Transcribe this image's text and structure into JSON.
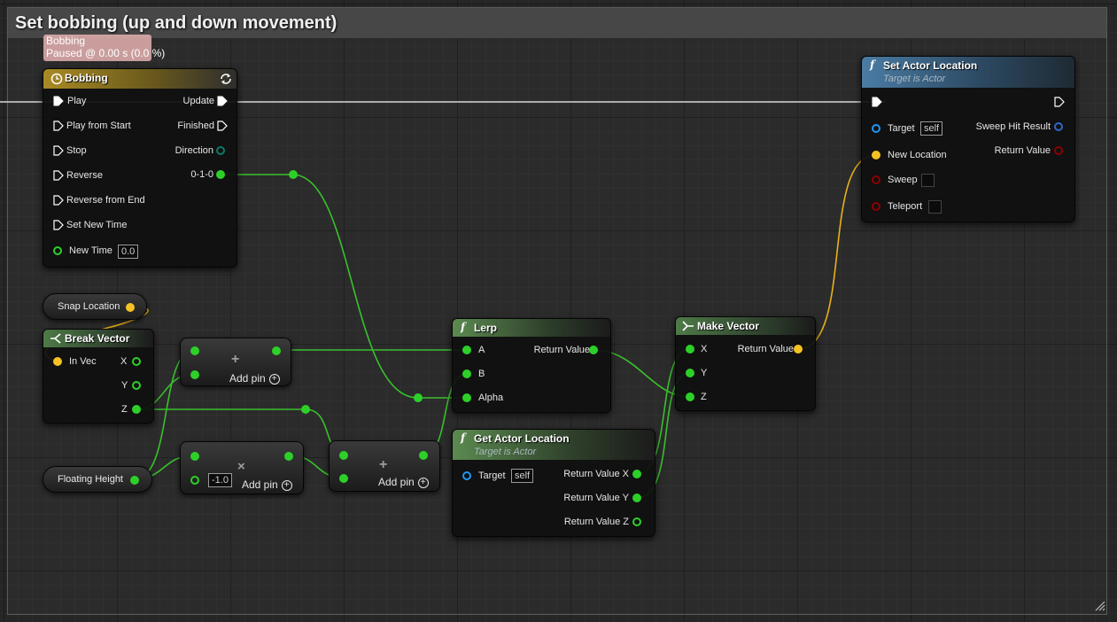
{
  "comment": {
    "title": "Set bobbing (up and down movement)"
  },
  "tooltip": {
    "line1": "Bobbing",
    "line2": "Paused @ 0.00 s (0.0 %)"
  },
  "colors": {
    "exec": "#ffffff",
    "float": "#2dd028",
    "vector": "#f4c223",
    "object": "#2196f3",
    "struct": "#2b6ac9",
    "bool": "#8e0000",
    "timeline_header": "#a48625",
    "function_header": "#78c8f0",
    "pure_header": "#4d7f42"
  },
  "timeline": {
    "title": "Bobbing",
    "inputs": [
      "Play",
      "Play from Start",
      "Stop",
      "Reverse",
      "Reverse from End",
      "Set New Time"
    ],
    "new_time_label": "New Time",
    "new_time_value": "0.0",
    "outputs": [
      "Update",
      "Finished",
      "Direction",
      "0-1-0"
    ]
  },
  "snap_location": {
    "label": "Snap Location"
  },
  "floating_height": {
    "label": "Floating Height"
  },
  "break_vector": {
    "title": "Break Vector",
    "input": "In Vec",
    "outputs": [
      "X",
      "Y",
      "Z"
    ]
  },
  "add_node_1": {
    "add_pin": "Add pin"
  },
  "mult_node": {
    "add_pin": "Add pin",
    "value": "-1.0"
  },
  "add_node_2": {
    "add_pin": "Add pin"
  },
  "lerp": {
    "title": "Lerp",
    "inputs": [
      "A",
      "B",
      "Alpha"
    ],
    "output": "Return Value"
  },
  "get_actor_location": {
    "title": "Get Actor Location",
    "subtitle": "Target is Actor",
    "target_label": "Target",
    "target_value": "self",
    "outputs": [
      "Return Value X",
      "Return Value Y",
      "Return Value Z"
    ]
  },
  "make_vector": {
    "title": "Make Vector",
    "inputs": [
      "X",
      "Y",
      "Z"
    ],
    "output": "Return Value"
  },
  "set_actor_location": {
    "title": "Set Actor Location",
    "subtitle": "Target is Actor",
    "target_label": "Target",
    "target_value": "self",
    "new_location": "New Location",
    "sweep": "Sweep",
    "teleport": "Teleport",
    "sweep_hit_result": "Sweep Hit Result",
    "return_value": "Return Value"
  }
}
